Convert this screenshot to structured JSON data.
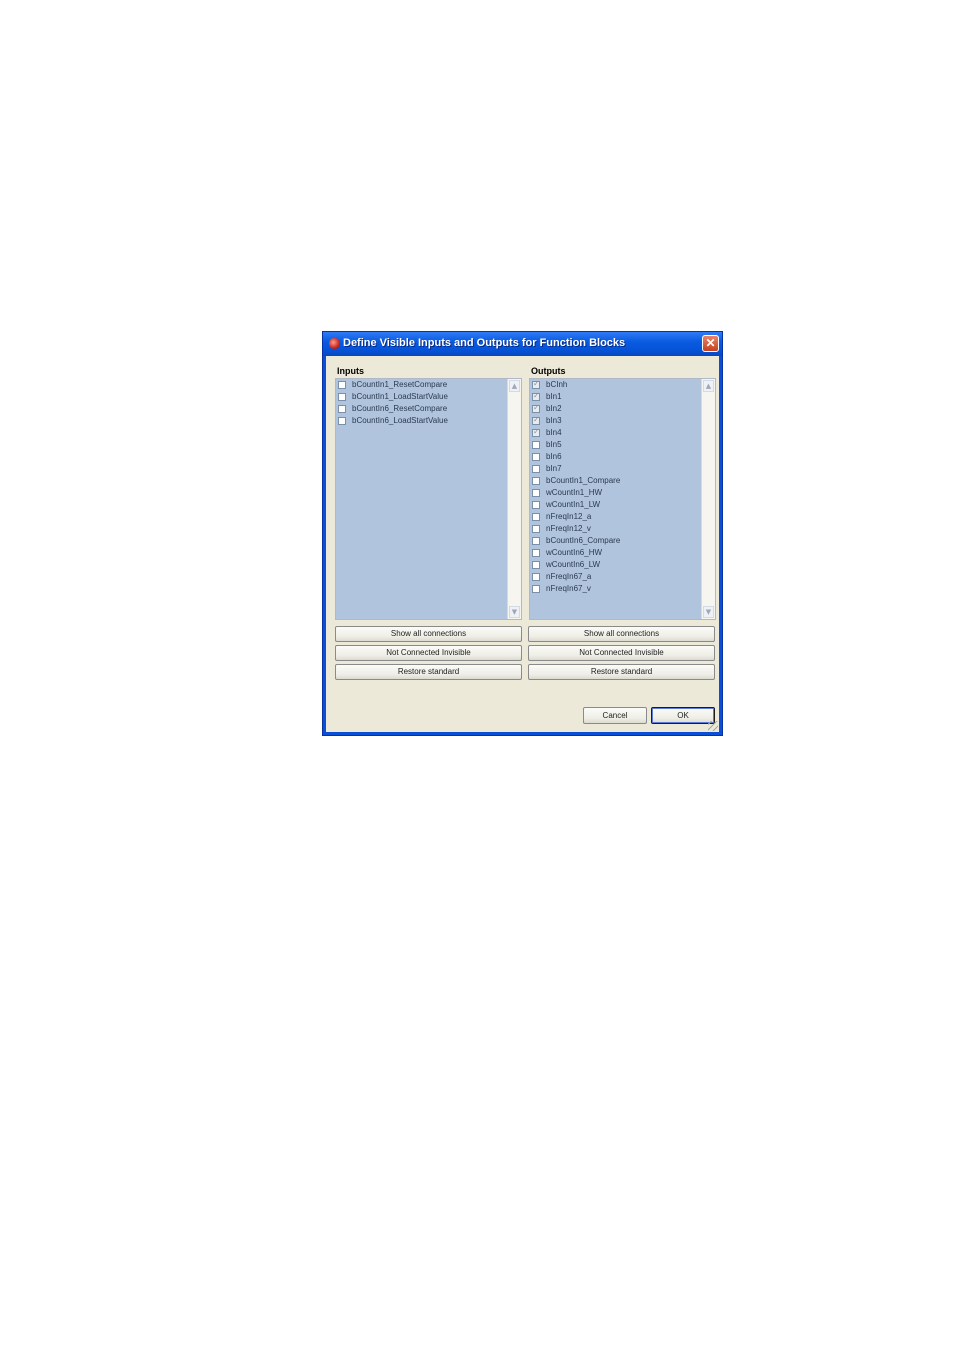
{
  "dialog": {
    "title": "Define Visible Inputs and Outputs for Function Blocks",
    "close_glyph": "✕"
  },
  "inputs": {
    "label": "Inputs",
    "items": [
      {
        "label": "bCountIn1_ResetCompare",
        "checked": false
      },
      {
        "label": "bCountIn1_LoadStartValue",
        "checked": false
      },
      {
        "label": "bCountIn6_ResetCompare",
        "checked": false
      },
      {
        "label": "bCountIn6_LoadStartValue",
        "checked": false
      }
    ],
    "buttons": {
      "show_all": "Show all connections",
      "not_connected": "Not Connected Invisible",
      "restore": "Restore standard"
    }
  },
  "outputs": {
    "label": "Outputs",
    "items": [
      {
        "label": "bCInh",
        "checked": true
      },
      {
        "label": "bIn1",
        "checked": true
      },
      {
        "label": "bIn2",
        "checked": true
      },
      {
        "label": "bIn3",
        "checked": true
      },
      {
        "label": "bIn4",
        "checked": true
      },
      {
        "label": "bIn5",
        "checked": false
      },
      {
        "label": "bIn6",
        "checked": false
      },
      {
        "label": "bIn7",
        "checked": false
      },
      {
        "label": "bCountIn1_Compare",
        "checked": false
      },
      {
        "label": "wCountIn1_HW",
        "checked": false
      },
      {
        "label": "wCountIn1_LW",
        "checked": false
      },
      {
        "label": "nFreqIn12_a",
        "checked": false
      },
      {
        "label": "nFreqIn12_v",
        "checked": false
      },
      {
        "label": "bCountIn6_Compare",
        "checked": false
      },
      {
        "label": "wCountIn6_HW",
        "checked": false
      },
      {
        "label": "wCountIn6_LW",
        "checked": false
      },
      {
        "label": "nFreqIn67_a",
        "checked": false
      },
      {
        "label": "nFreqIn67_v",
        "checked": false
      }
    ],
    "buttons": {
      "show_all": "Show all connections",
      "not_connected": "Not Connected Invisible",
      "restore": "Restore standard"
    }
  },
  "footer": {
    "cancel_label": "Cancel",
    "ok_label": "OK"
  },
  "icons": {
    "scroll_up": "chevron-up-icon",
    "scroll_down": "chevron-down-icon",
    "app": "app-icon",
    "close": "close-icon"
  },
  "colors": {
    "titlebar": "#0a5be0",
    "list_background": "#b0c4de",
    "dialog_background": "#ece9d8"
  }
}
